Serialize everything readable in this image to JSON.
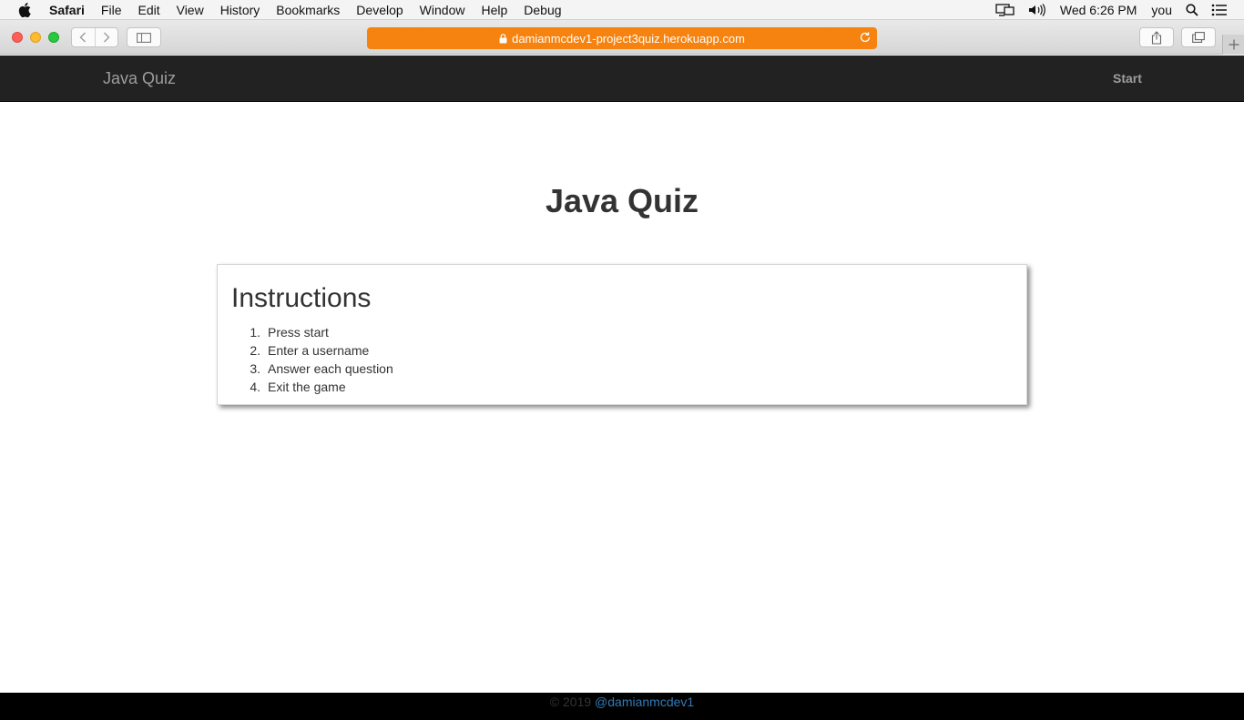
{
  "menubar": {
    "app_name": "Safari",
    "items": [
      "File",
      "Edit",
      "View",
      "History",
      "Bookmarks",
      "Develop",
      "Window",
      "Help",
      "Debug"
    ],
    "clock": "Wed 6:26 PM",
    "user": "you"
  },
  "browser": {
    "url": "damianmcdev1-project3quiz.herokuapp.com",
    "accent_color": "#f6820f"
  },
  "site_nav": {
    "brand": "Java Quiz",
    "start_link": "Start"
  },
  "main": {
    "title": "Java Quiz",
    "instructions": {
      "heading": "Instructions",
      "steps": [
        {
          "num": "1.",
          "text": "Press start"
        },
        {
          "num": "2.",
          "text": "Enter a username"
        },
        {
          "num": "3.",
          "text": "Answer each question"
        },
        {
          "num": "4.",
          "text": "Exit the game"
        }
      ]
    }
  },
  "footer": {
    "copyright": "© 2019",
    "author_link": "@damianmcdev1"
  }
}
